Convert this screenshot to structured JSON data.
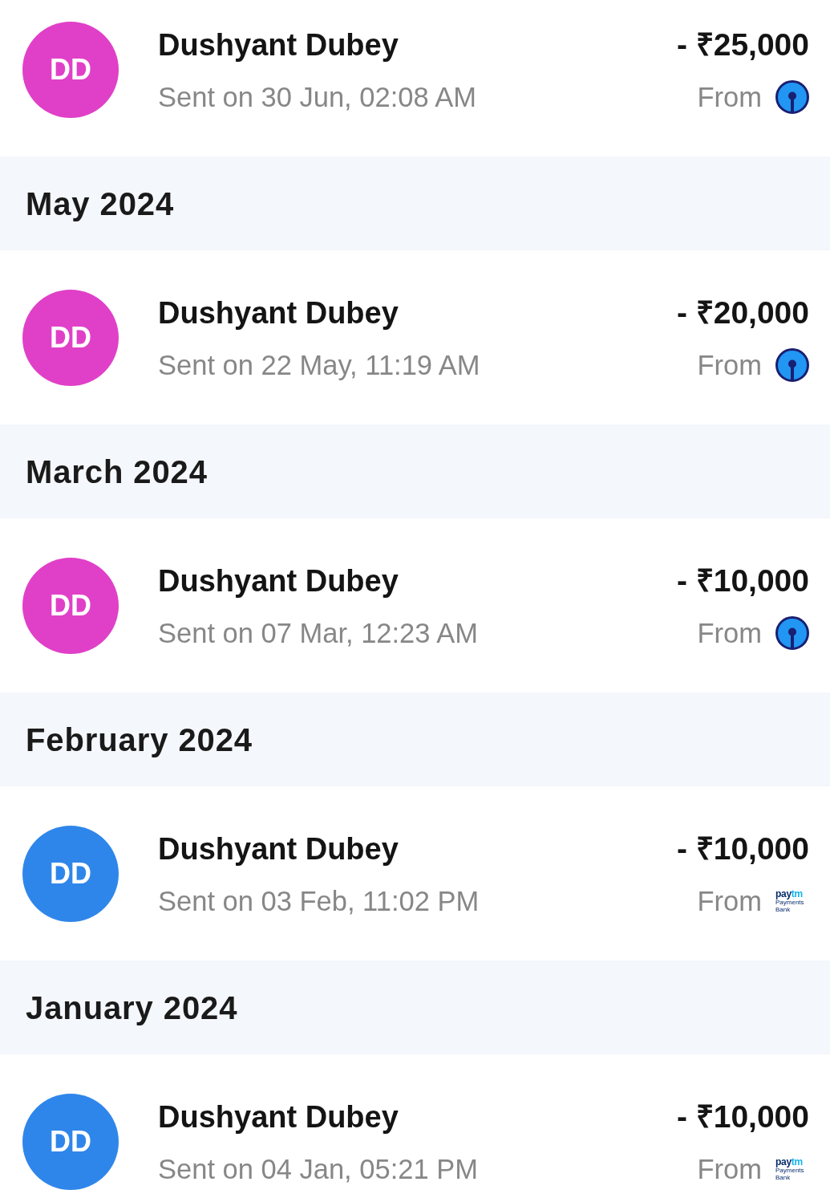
{
  "list": [
    {
      "kind": "transaction",
      "initials": "DD",
      "color": "#e040c8",
      "name": "Dushyant Dubey",
      "detail": "Sent on 30 Jun, 02:08 AM",
      "amount": "- ₹25,000",
      "source_label": "From",
      "source": {
        "kind": "keyhole"
      }
    },
    {
      "kind": "month_header",
      "label": "May 2024"
    },
    {
      "kind": "transaction",
      "initials": "DD",
      "color": "#e040c8",
      "name": "Dushyant Dubey",
      "detail": "Sent on 22 May, 11:19 AM",
      "amount": "- ₹20,000",
      "source_label": "From",
      "source": {
        "kind": "keyhole"
      }
    },
    {
      "kind": "month_header",
      "label": "March 2024"
    },
    {
      "kind": "transaction",
      "initials": "DD",
      "color": "#e040c8",
      "name": "Dushyant Dubey",
      "detail": "Sent on 07 Mar, 12:23 AM",
      "amount": "- ₹10,000",
      "source_label": "From",
      "source": {
        "kind": "keyhole"
      }
    },
    {
      "kind": "month_header",
      "label": "February 2024"
    },
    {
      "kind": "transaction",
      "initials": "DD",
      "color": "#2f86ea",
      "name": "Dushyant Dubey",
      "detail": "Sent on 03 Feb, 11:02 PM",
      "amount": "- ₹10,000",
      "source_label": "From",
      "source": {
        "kind": "wordmark",
        "wordmark": [
          "pay",
          "tm"
        ],
        "caption": [
          "Payments",
          "Bank"
        ]
      }
    },
    {
      "kind": "month_header",
      "label": "January 2024"
    },
    {
      "kind": "transaction",
      "initials": "DD",
      "color": "#2f86ea",
      "name": "Dushyant Dubey",
      "detail": "Sent on 04 Jan, 05:21 PM",
      "amount": "- ₹10,000",
      "source_label": "From",
      "source": {
        "kind": "wordmark",
        "wordmark": [
          "pay",
          "tm"
        ],
        "caption": [
          "Payments",
          "Bank"
        ]
      }
    }
  ]
}
